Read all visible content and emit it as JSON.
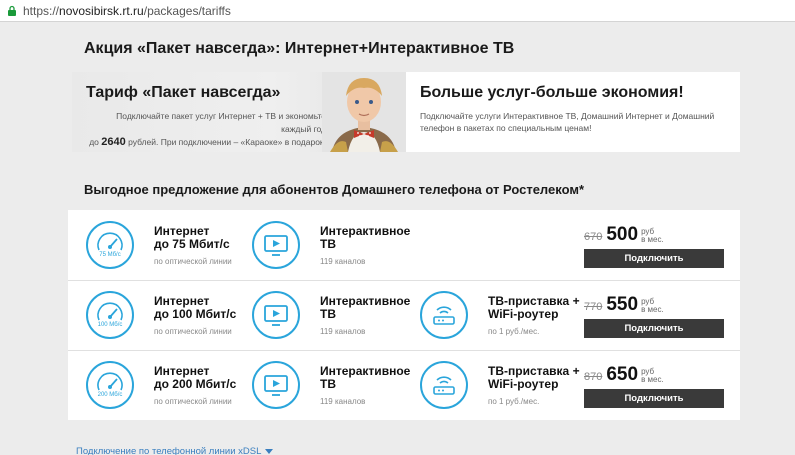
{
  "browser": {
    "url_scheme": "https://",
    "url_host": "novosibirsk.rt.ru",
    "url_path": "/packages/tariffs"
  },
  "page": {
    "title": "Акция «Пакет навсегда»: Интернет+Интерактивное ТВ",
    "section_title": "Выгодное предложение для абонентов Домашнего телефона от Ростелеком*",
    "xdsl_link": "Подключение по телефонной линии xDSL"
  },
  "banner": {
    "left": {
      "title": "Тариф «Пакет навсегда»",
      "text_1": "Подключайте пакет услуг Интернет + ТВ и экономьте каждый год",
      "text_2_prefix": "до",
      "text_2_amount": "2640",
      "text_2_suffix": "рублей. При подключении – «Караоке» в подарок!"
    },
    "right": {
      "title": "Больше услуг-больше экономия!",
      "text": "Подключайте услуги Интерактивное ТВ, Домашний Интернет и Домашний телефон в пакетах по специальным ценам!"
    }
  },
  "tariffs": [
    {
      "internet": {
        "name_1": "Интернет",
        "name_2": "до 75 Мбит/с",
        "sub": "по оптической линии",
        "gauge": "75 Мб/с"
      },
      "tv": {
        "name_1": "Интерактивное",
        "name_2": "ТВ",
        "sub": "119 каналов"
      },
      "router": null,
      "old_price": "670",
      "new_price": "500",
      "unit_1": "руб",
      "unit_2": "в мес.",
      "button": "Подключить"
    },
    {
      "internet": {
        "name_1": "Интернет",
        "name_2": "до 100 Мбит/с",
        "sub": "по оптической линии",
        "gauge": "100 Мб/с"
      },
      "tv": {
        "name_1": "Интерактивное",
        "name_2": "ТВ",
        "sub": "119 каналов"
      },
      "router": {
        "name_1": "ТВ-приставка +",
        "name_2": "WiFi-роутер",
        "sub": "по 1 руб./мес."
      },
      "old_price": "770",
      "new_price": "550",
      "unit_1": "руб",
      "unit_2": "в мес.",
      "button": "Подключить"
    },
    {
      "internet": {
        "name_1": "Интернет",
        "name_2": "до 200 Мбит/с",
        "sub": "по оптической линии",
        "gauge": "200 Мб/с"
      },
      "tv": {
        "name_1": "Интерактивное",
        "name_2": "ТВ",
        "sub": "119 каналов"
      },
      "router": {
        "name_1": "ТВ-приставка +",
        "name_2": "WiFi-роутер",
        "sub": "по 1 руб./мес."
      },
      "old_price": "870",
      "new_price": "650",
      "unit_1": "руб",
      "unit_2": "в мес.",
      "button": "Подключить"
    }
  ],
  "icons": {
    "lock": "lock-icon",
    "speed": "speedometer-icon",
    "tv": "tv-icon",
    "router": "router-icon"
  },
  "colors": {
    "accent": "#2aa5db",
    "button": "#3a3a3a",
    "link": "#3a7fbf"
  }
}
